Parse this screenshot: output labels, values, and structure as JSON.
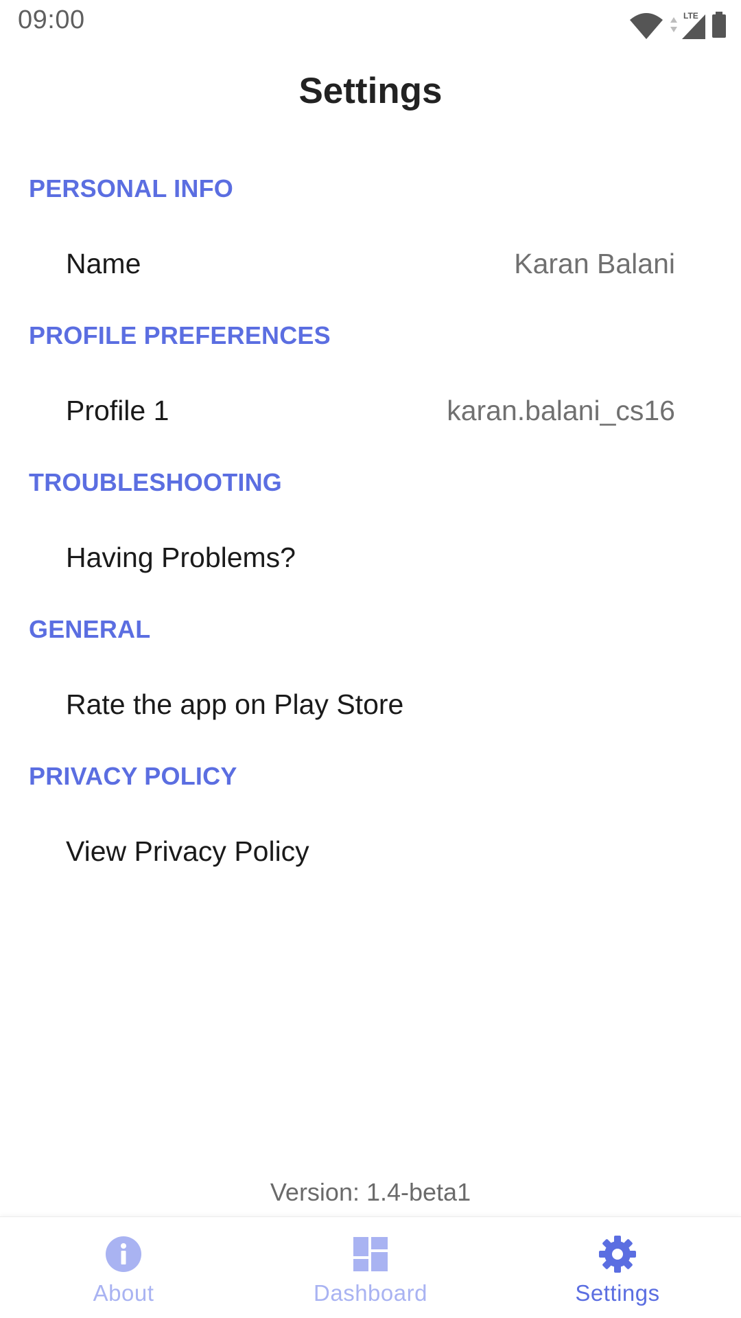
{
  "status_bar": {
    "time": "09:00",
    "network": "LTE",
    "icons": [
      "wifi-icon",
      "cell-signal-icon",
      "battery-icon"
    ]
  },
  "header": {
    "title": "Settings"
  },
  "sections": [
    {
      "header": "PERSONAL INFO",
      "rows": [
        {
          "label": "Name",
          "value": "Karan Balani"
        }
      ]
    },
    {
      "header": "PROFILE PREFERENCES",
      "rows": [
        {
          "label": "Profile 1",
          "value": "karan.balani_cs16"
        }
      ]
    },
    {
      "header": "TROUBLESHOOTING",
      "rows": [
        {
          "label": "Having Problems?"
        }
      ]
    },
    {
      "header": "GENERAL",
      "rows": [
        {
          "label": "Rate the app on Play Store"
        }
      ]
    },
    {
      "header": "PRIVACY POLICY",
      "rows": [
        {
          "label": "View Privacy Policy"
        }
      ]
    }
  ],
  "version": "Version: 1.4-beta1",
  "bottom_nav": {
    "items": [
      {
        "label": "About",
        "icon": "info-icon",
        "active": false
      },
      {
        "label": "Dashboard",
        "icon": "dashboard-icon",
        "active": false
      },
      {
        "label": "Settings",
        "icon": "gear-icon",
        "active": true
      }
    ]
  },
  "colors": {
    "accent": "#5b6ee1",
    "accent_inactive": "#a9b3f2",
    "title": "#222222",
    "row_label": "#1a1a1a",
    "row_value": "#707070"
  }
}
